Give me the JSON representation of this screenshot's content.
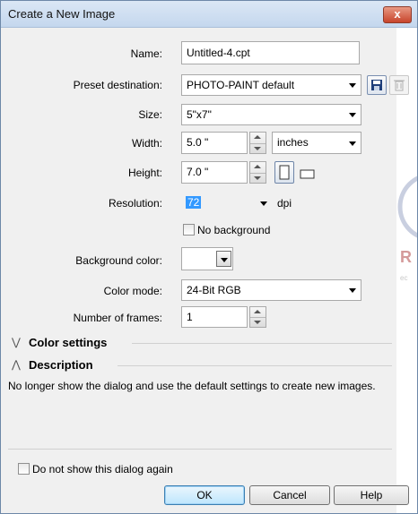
{
  "window": {
    "title": "Create a New Image",
    "close_glyph": "x"
  },
  "form": {
    "name_label": "Name:",
    "name_value": "Untitled-4.cpt",
    "preset_label": "Preset destination:",
    "preset_value": "PHOTO-PAINT default",
    "size_label": "Size:",
    "size_value": "5\"x7\"",
    "width_label": "Width:",
    "width_value": "5.0 \"",
    "units_value": "inches",
    "height_label": "Height:",
    "height_value": "7.0 \"",
    "resolution_label": "Resolution:",
    "resolution_value": "72",
    "resolution_unit": "dpi",
    "no_background_label": "No background",
    "bg_color_label": "Background color:",
    "color_mode_label": "Color mode:",
    "color_mode_value": "24-Bit RGB",
    "frames_label": "Number of frames:",
    "frames_value": "1"
  },
  "sections": {
    "color_settings": "Color settings",
    "description": "Description",
    "description_text": "No longer show the dialog and use the default settings to create new images."
  },
  "footer": {
    "dont_show_label": "Do not show this dialog again",
    "ok_label": "OK",
    "cancel_label": "Cancel",
    "help_label": "Help"
  },
  "icons": {
    "save_preset": "save-icon",
    "delete_preset": "trash-icon",
    "portrait": "portrait-icon",
    "landscape": "landscape-icon"
  },
  "colors": {
    "selection": "#3399ff",
    "background_swatch": "#ffffff"
  }
}
